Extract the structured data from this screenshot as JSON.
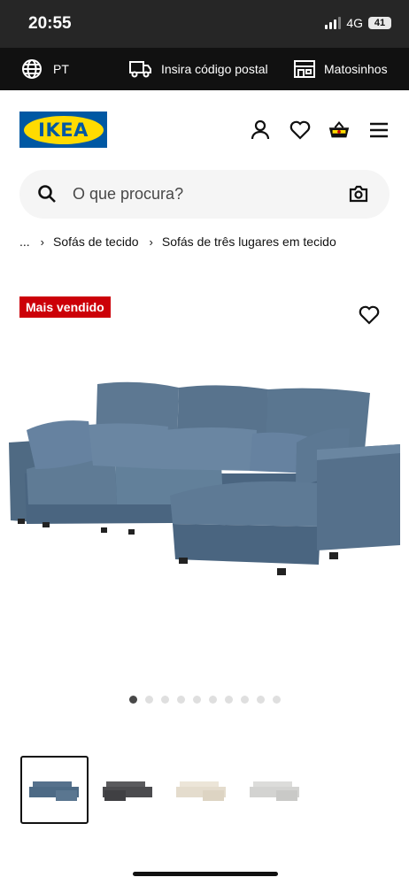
{
  "status_bar": {
    "time": "20:55",
    "network": "4G",
    "battery": "41"
  },
  "topbar": {
    "language": "PT",
    "postal_code": "Insira código postal",
    "store": "Matosinhos"
  },
  "header": {
    "logo_text": "IKEA",
    "icons": [
      "user-icon",
      "heart-icon",
      "basket-icon",
      "menu-icon"
    ]
  },
  "search": {
    "placeholder": "O que procura?"
  },
  "breadcrumb": {
    "ellipsis": "...",
    "items": [
      "Sofás de tecido",
      "Sofás de três lugares em tecido"
    ]
  },
  "product": {
    "badge": "Mais vendido",
    "image_index": 1,
    "image_count": 10,
    "thumbnails": [
      {
        "color": "#4d6a85",
        "selected": true
      },
      {
        "color": "#4b4b4e",
        "selected": false
      },
      {
        "color": "#e4dccd",
        "selected": false
      },
      {
        "color": "#d3d3d1",
        "selected": false
      }
    ]
  },
  "colors": {
    "ikea_blue": "#0058a3",
    "ikea_yellow": "#ffdb00",
    "badge_red": "#cc0008",
    "sofa_blue": "#5a7690"
  }
}
